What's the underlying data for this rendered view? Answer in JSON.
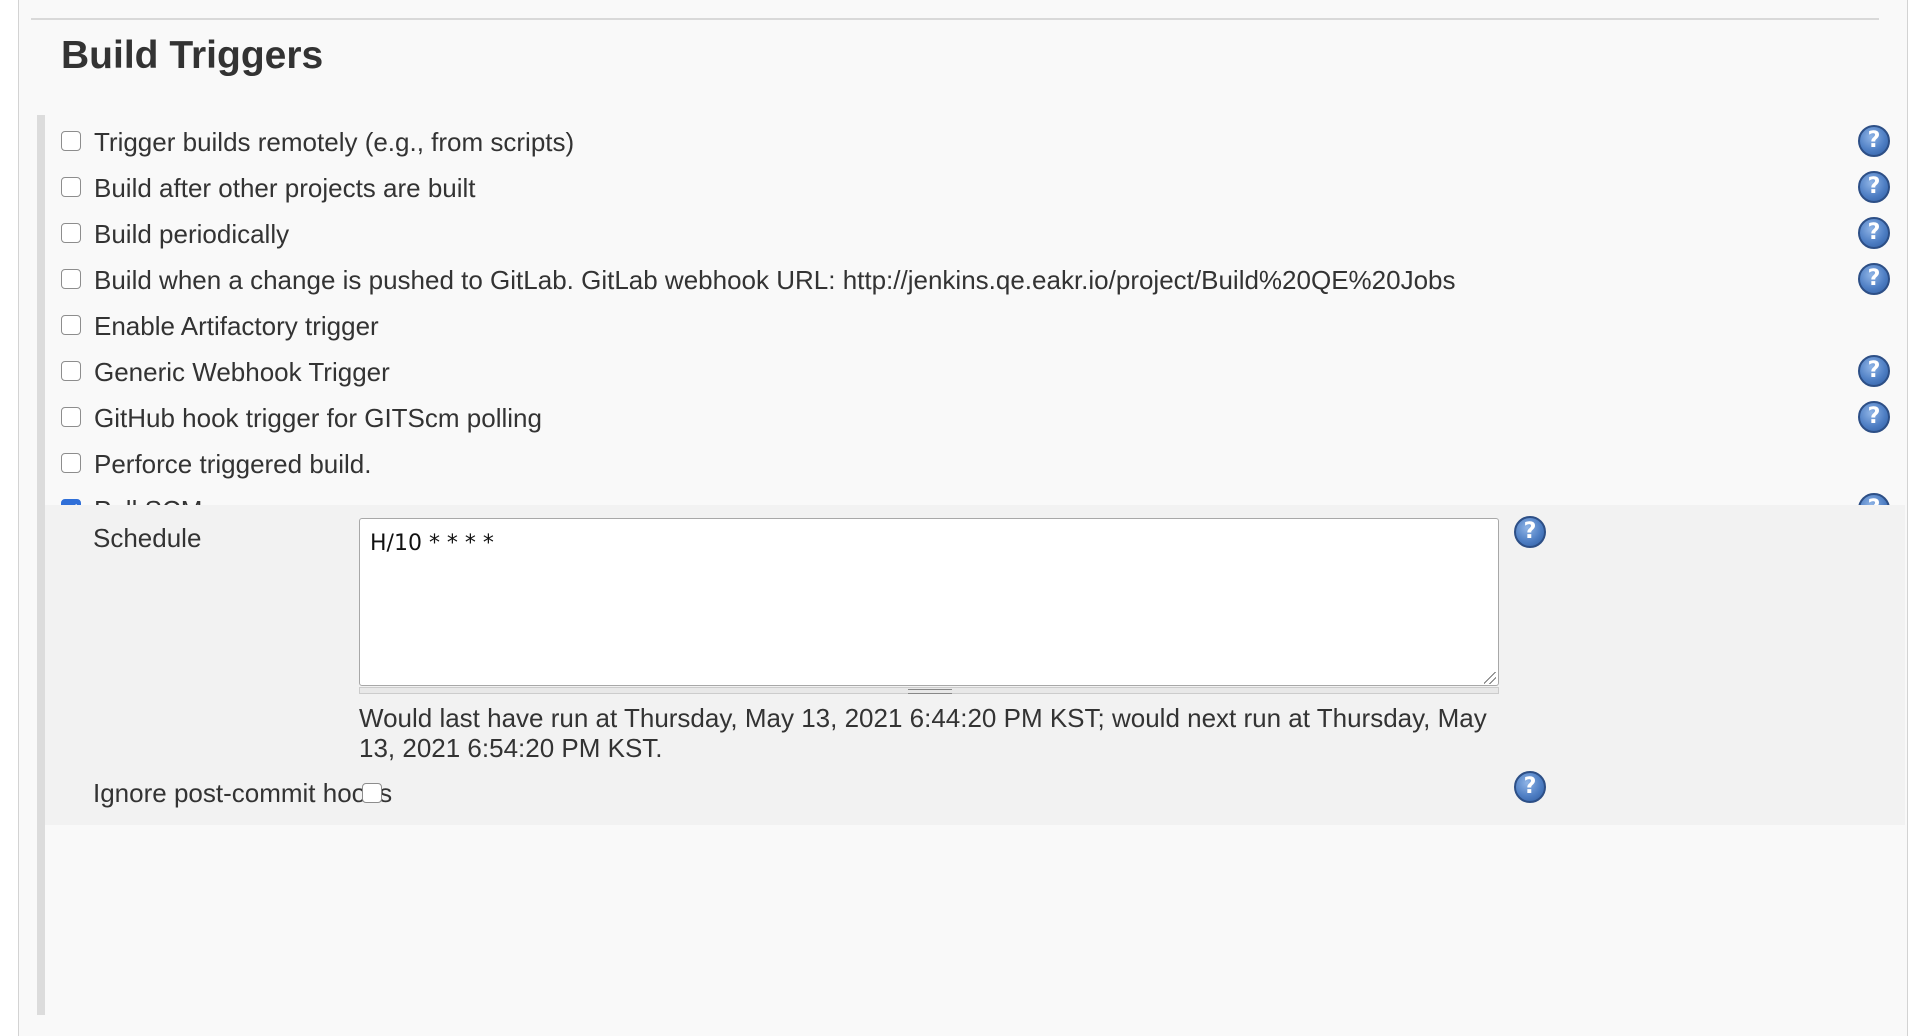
{
  "section": {
    "title": "Build Triggers"
  },
  "triggers": [
    {
      "label": "Trigger builds remotely (e.g., from scripts)",
      "checked": false,
      "help": true
    },
    {
      "label": "Build after other projects are built",
      "checked": false,
      "help": true
    },
    {
      "label": "Build periodically",
      "checked": false,
      "help": true
    },
    {
      "label": "Build when a change is pushed to GitLab. GitLab webhook URL: http://jenkins.qe.eakr.io/project/Build%20QE%20Jobs",
      "checked": false,
      "help": true
    },
    {
      "label": "Enable Artifactory trigger",
      "checked": false,
      "help": false
    },
    {
      "label": "Generic Webhook Trigger",
      "checked": false,
      "help": true
    },
    {
      "label": "GitHub hook trigger for GITScm polling",
      "checked": false,
      "help": true
    },
    {
      "label": "Perforce triggered build.",
      "checked": false,
      "help": false
    },
    {
      "label": "Poll SCM",
      "checked": true,
      "help": true
    }
  ],
  "poll_scm": {
    "schedule_label": "Schedule",
    "schedule_value": "H/10 * * * *",
    "schedule_info": "Would last have run at Thursday, May 13, 2021 6:44:20 PM KST; would next run at Thursday, May 13, 2021 6:54:20 PM KST.",
    "ignore_hooks_label": "Ignore post-commit hooks",
    "ignore_hooks_checked": false
  },
  "icons": {
    "help": "help-question-icon",
    "help_color": "#4f7fc4",
    "checkbox_checked_color": "#2f6fd8"
  }
}
